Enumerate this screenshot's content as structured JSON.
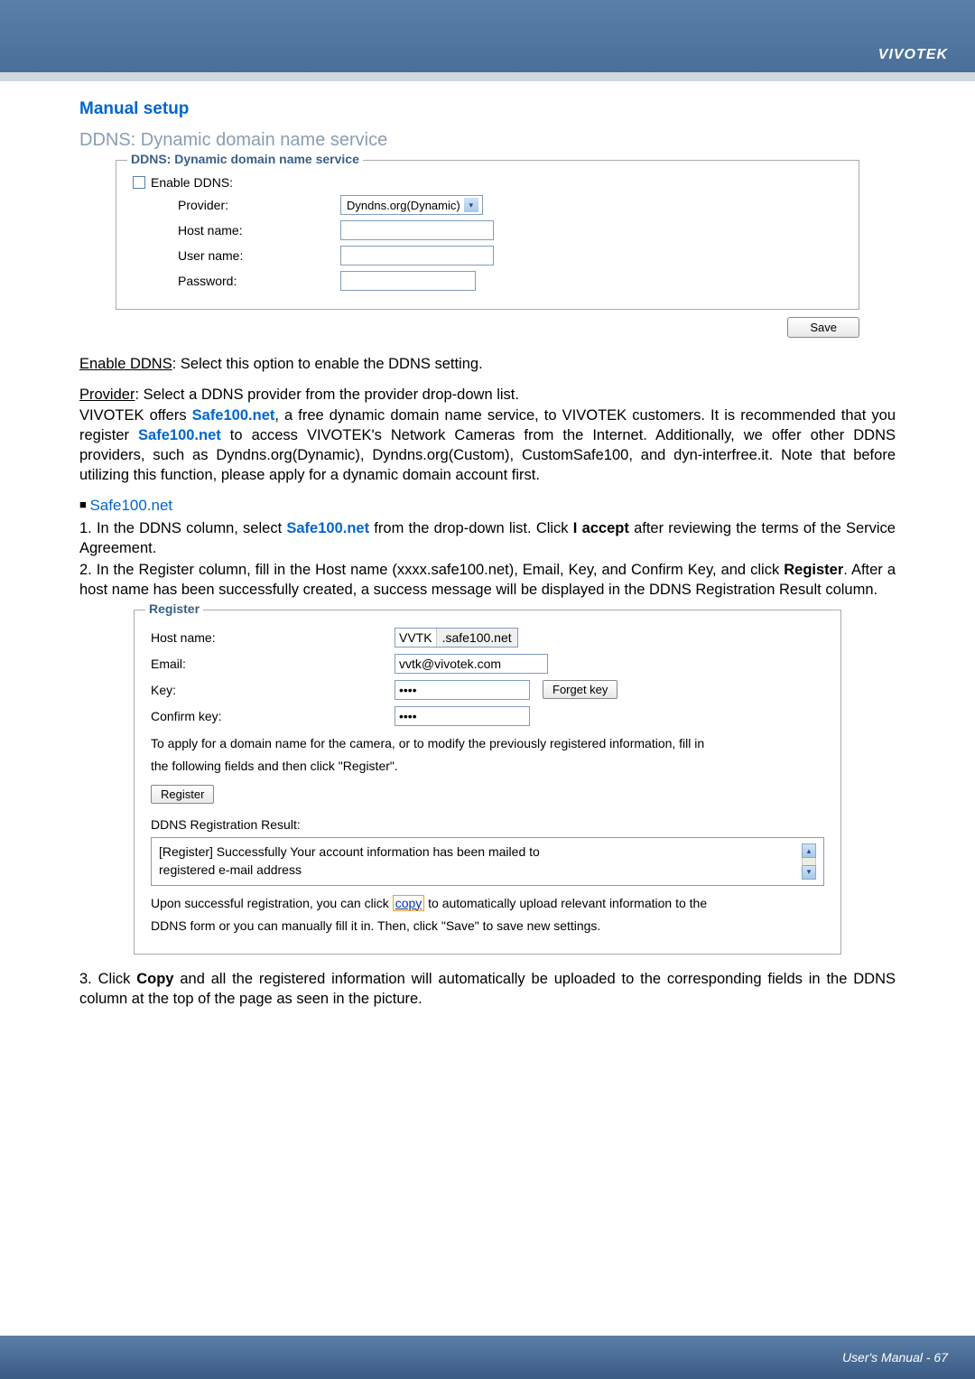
{
  "header": {
    "brand": "VIVOTEK"
  },
  "section": {
    "title": "Manual setup",
    "subtitle": "DDNS: Dynamic domain name service"
  },
  "ddns_form": {
    "legend": "DDNS: Dynamic domain name service",
    "enable_label": "Enable DDNS:",
    "provider_label": "Provider:",
    "provider_value": "Dyndns.org(Dynamic)",
    "hostname_label": "Host name:",
    "username_label": "User name:",
    "password_label": "Password:",
    "save": "Save"
  },
  "para1_pre": "Enable DDNS",
  "para1_rest": ": Select this option to enable the DDNS setting.",
  "para2_pre": "Provider",
  "para2_rest": ": Select a DDNS provider from the provider drop-down list.",
  "para3_a": "VIVOTEK offers ",
  "para3_link1": "Safe100.net",
  "para3_b": ", a free dynamic domain name service, to VIVOTEK customers. It is recommended that you register ",
  "para3_link2": "Safe100.net",
  "para3_c": " to access VIVOTEK's Network Cameras from the Internet. Additionally, we offer other DDNS providers, such as Dyndns.org(Dynamic), Dyndns.org(Custom), CustomSafe100, and dyn-interfree.it. Note that before utilizing this function, please apply for a dynamic domain account first.",
  "bullet_title": "Safe100.net",
  "steps": {
    "s1_a": "1. In the DDNS column, select ",
    "s1_link": "Safe100.net",
    "s1_b": " from the drop-down list. Click ",
    "s1_bold": "I accept",
    "s1_c": " after reviewing the terms of the Service Agreement.",
    "s2_a": "2. In the Register column, fill in the Host name (xxxx.safe100.net), Email, Key, and Confirm Key, and click ",
    "s2_bold": "Register",
    "s2_b": ". After a host name has been successfully created, a success message will be displayed in the DDNS Registration Result column."
  },
  "register_form": {
    "legend": "Register",
    "hostname_label": "Host name:",
    "hostname_value": "VVTK",
    "hostname_suffix": ".safe100.net",
    "email_label": "Email:",
    "email_value": "vvtk@vivotek.com",
    "key_label": "Key:",
    "key_value": "••••",
    "forget_key": "Forget key",
    "confirm_label": "Confirm key:",
    "confirm_value": "••••",
    "instr1": "To apply for a domain name for the camera, or to modify the previously registered information, fill in",
    "instr2": "the following fields and then click \"Register\".",
    "register_btn": "Register",
    "result_label": "DDNS Registration Result:",
    "result_text": "[Register] Successfully Your account information has been mailed to registered e-mail address",
    "post_a": "Upon successful registration, you can click ",
    "post_copy": "copy",
    "post_b": " to automatically upload relevant information to the",
    "post_c": "DDNS form or you can manually fill it in. Then, click \"Save\" to save new settings."
  },
  "step3_a": "3. Click ",
  "step3_bold": "Copy",
  "step3_b": " and all the registered information will automatically be uploaded to the corresponding fields in the DDNS column at the top of the page as seen in the picture.",
  "footer": {
    "text": "User's Manual - 67"
  }
}
